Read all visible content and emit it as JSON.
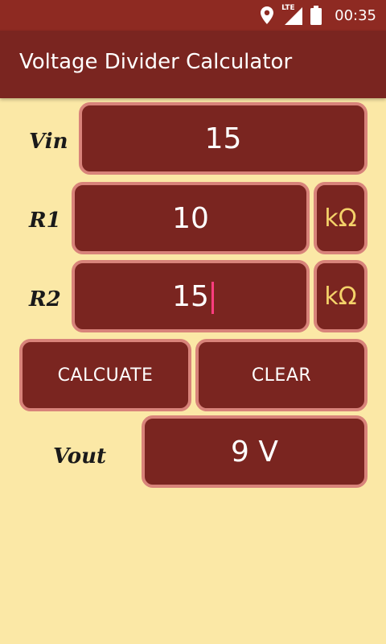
{
  "status_bar": {
    "time": "00:35",
    "network_label": "LTE",
    "icons": [
      "location-icon",
      "signal-icon",
      "battery-icon"
    ]
  },
  "app_bar": {
    "title": "Voltage Divider Calculator"
  },
  "form": {
    "vin": {
      "label": "Vin",
      "value": "15"
    },
    "r1": {
      "label": "R1",
      "value": "10",
      "unit": "kΩ"
    },
    "r2": {
      "label": "R2",
      "value": "15",
      "unit": "kΩ"
    }
  },
  "buttons": {
    "calculate_label": "CALCUATE",
    "clear_label": "CLEAR"
  },
  "result": {
    "label": "Vout",
    "value": "9 V"
  },
  "colors": {
    "background": "#FBE8A6",
    "primary": "#7A2520",
    "status_bar": "#8E2A22",
    "border": "#D8837A",
    "unit_text": "#F4D26A",
    "cursor": "#FF3D7F"
  }
}
